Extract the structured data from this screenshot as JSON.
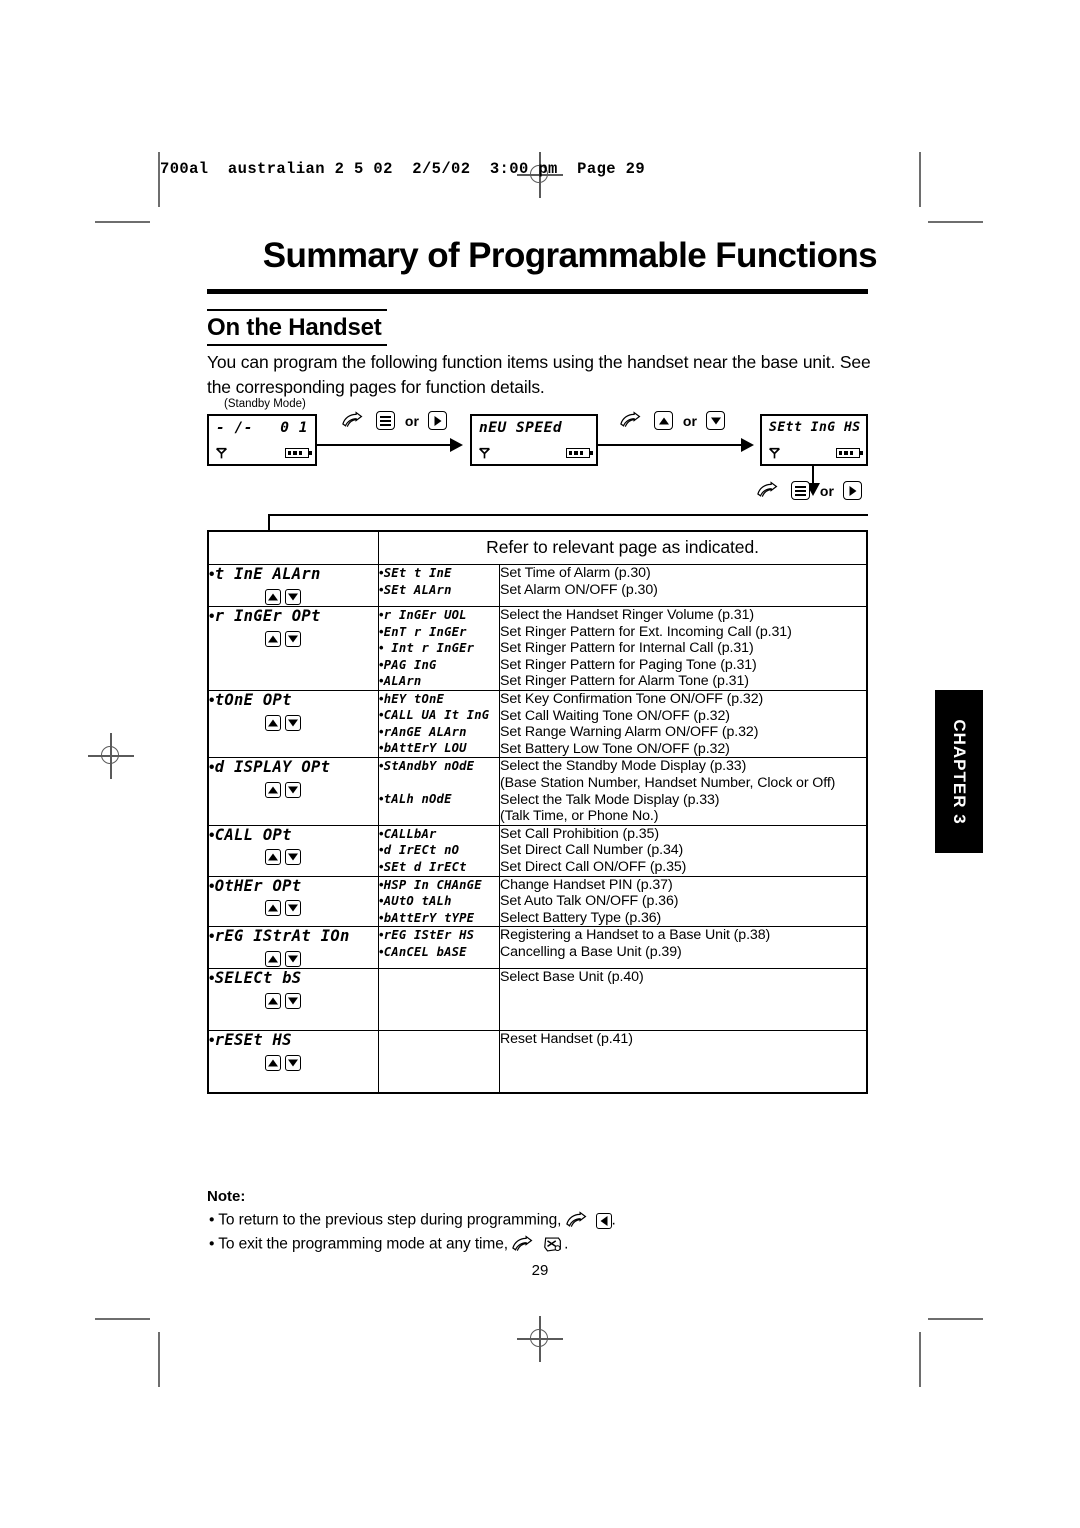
{
  "print_header": "700al  australian 2 5 02  2/5/02  3:00 pm  Page 29",
  "title": "Summary of Programmable Functions",
  "subtitle": "On the Handset",
  "intro": "You can program the following function items using the handset near the base unit. See the corresponding pages for function details.",
  "flow": {
    "standby_label": "(Standby Mode)",
    "lcd1_left": "- /-",
    "lcd1_right": "0 1",
    "lcd2": "nEU SPEEd",
    "lcd3": "SEtt InG HS",
    "step1_or": "or",
    "step2_or": "or",
    "step3_or": "or",
    "icons": {
      "hand": "pointing-hand-icon",
      "menu_key": "menu-key-icon",
      "right_key": "right-arrow-key-icon",
      "up_key": "up-arrow-key-icon",
      "down_key": "down-arrow-key-icon",
      "antenna": "antenna-icon",
      "battery": "battery-icon"
    }
  },
  "table": {
    "refer_header": "Refer to relevant page as indicated.",
    "rows": [
      {
        "menu": "t InE ALArn",
        "items": [
          {
            "code": "SEt t InE",
            "desc": [
              "Set Time of Alarm (p.30)"
            ]
          },
          {
            "code": "SEt ALArn",
            "desc": [
              "Set Alarm ON/OFF (p.30)"
            ]
          }
        ]
      },
      {
        "menu": "r InGEr OPt",
        "items": [
          {
            "code": "r InGEr UOL",
            "desc": [
              "Select the Handset Ringer Volume (p.31)"
            ]
          },
          {
            "code": "EnT r InGEr",
            "desc": [
              "Set Ringer Pattern for Ext. Incoming Call (p.31)"
            ]
          },
          {
            "code": " Int r InGEr",
            "desc": [
              "Set Ringer Pattern for Internal Call (p.31)"
            ]
          },
          {
            "code": "PAG InG",
            "desc": [
              "Set Ringer Pattern for Paging Tone (p.31)"
            ]
          },
          {
            "code": "ALArn",
            "desc": [
              "Set Ringer Pattern for Alarm Tone (p.31)"
            ]
          }
        ]
      },
      {
        "menu": "tOnE OPt",
        "items": [
          {
            "code": "hEY tOnE",
            "desc": [
              "Set Key Confirmation Tone ON/OFF (p.32)"
            ]
          },
          {
            "code": "CALL UA It InG",
            "desc": [
              "Set Call Waiting Tone ON/OFF (p.32)"
            ]
          },
          {
            "code": "rAnGE ALArn",
            "desc": [
              "Set Range Warning Alarm ON/OFF (p.32)"
            ]
          },
          {
            "code": "bAttErY LOU",
            "desc": [
              "Set Battery Low Tone ON/OFF (p.32)"
            ]
          }
        ]
      },
      {
        "menu": "d ISPLAY OPt",
        "items": [
          {
            "code": "StAndbY nOdE",
            "desc": [
              "Select the Standby Mode Display (p.33)",
              "(Base Station Number, Handset Number, Clock or Off)"
            ]
          },
          {
            "code": "tALh nOdE",
            "desc": [
              "Select the Talk Mode Display (p.33)",
              "(Talk Time, or Phone No.)"
            ]
          }
        ]
      },
      {
        "menu": "CALL OPt",
        "items": [
          {
            "code": "CALLbAr",
            "desc": [
              "Set Call Prohibition (p.35)"
            ]
          },
          {
            "code": "d IrECt nO",
            "desc": [
              "Set Direct Call Number (p.34)"
            ]
          },
          {
            "code": "SEt d IrECt",
            "desc": [
              "Set Direct Call ON/OFF (p.35)"
            ]
          }
        ]
      },
      {
        "menu": "OtHEr OPt",
        "items": [
          {
            "code": "HSP In CHAnGE",
            "desc": [
              "Change Handset PIN (p.37)"
            ]
          },
          {
            "code": "AUtO tALh",
            "desc": [
              "Set Auto Talk ON/OFF (p.36)"
            ]
          },
          {
            "code": "bAttErY tYPE",
            "desc": [
              "Select Battery Type (p.36)"
            ]
          }
        ]
      },
      {
        "menu": "rEG IStrAt IOn",
        "items": [
          {
            "code": "rEG IStEr HS",
            "desc": [
              "Registering a Handset to a Base Unit (p.38)"
            ]
          },
          {
            "code": "CAnCEL bASE",
            "desc": [
              "Cancelling a Base Unit (p.39)"
            ]
          }
        ]
      },
      {
        "menu": "SELECt bS",
        "items": [
          {
            "code": "",
            "desc": [
              "Select Base Unit (p.40)"
            ]
          }
        ]
      },
      {
        "menu": "rESEt HS",
        "items": [
          {
            "code": "",
            "desc": [
              "Reset Handset (p.41)"
            ]
          }
        ]
      }
    ]
  },
  "note": {
    "title": "Note:",
    "line1_pre": "• To return to the previous step during programming,",
    "line1_post": ".",
    "line2_pre": "• To exit the programming mode at any time,",
    "line2_post": "."
  },
  "page_number": "29",
  "chapter_tab": "CHAPTER 3"
}
